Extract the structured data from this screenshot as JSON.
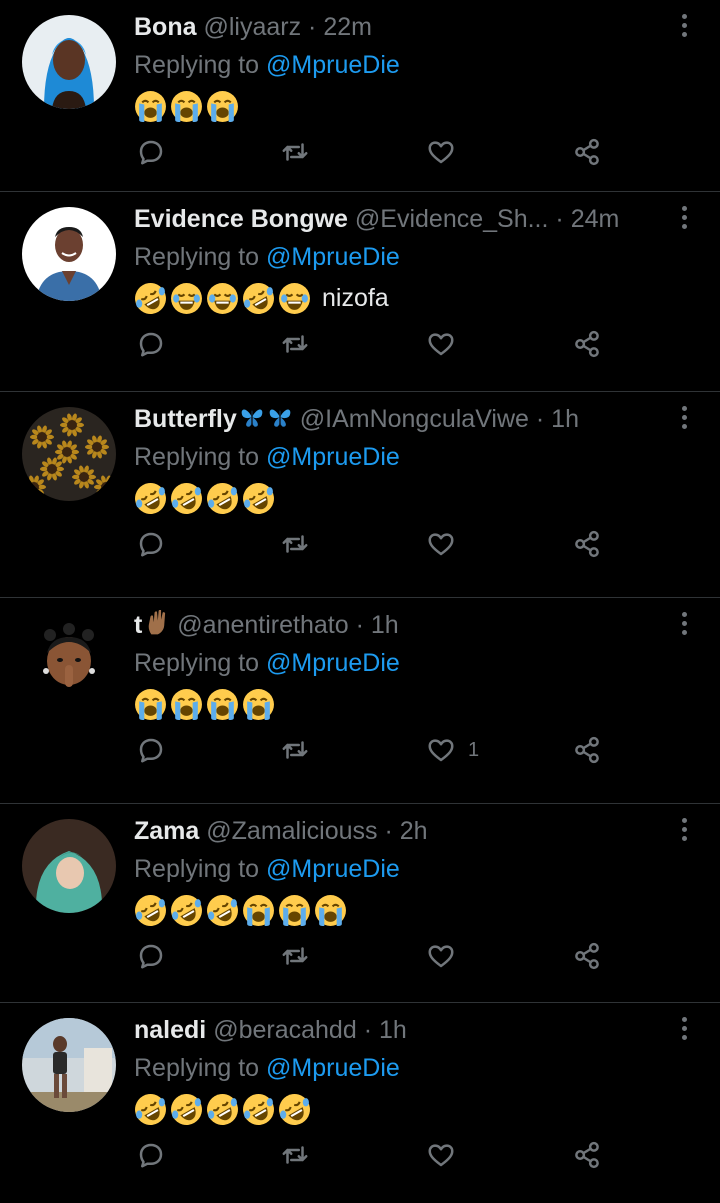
{
  "replying_label": "Replying to",
  "tweets": [
    {
      "name": "Bona",
      "name_emojis": [],
      "handle": "@liyaarz",
      "dot": "·",
      "time": "22m",
      "mention": "@MprueDie",
      "emojis": [
        "cry",
        "cry",
        "cry"
      ],
      "text": "",
      "likes": "",
      "avatar": "blue-hair-woman"
    },
    {
      "name": "Evidence Bongwe",
      "name_emojis": [],
      "handle": "@Evidence_Sh...",
      "dot": "·",
      "time": "24m",
      "mention": "@MprueDie",
      "emojis": [
        "rofl",
        "joy",
        "joy",
        "rofl",
        "joy"
      ],
      "text": "nizofa",
      "likes": "",
      "avatar": "smiling-man"
    },
    {
      "name": "Butterfly",
      "name_emojis": [
        "butterfly",
        "butterfly"
      ],
      "handle": "@IAmNongculaViwe",
      "dot": "·",
      "time": "1h",
      "mention": "@MprueDie",
      "emojis": [
        "rofl",
        "rofl",
        "rofl",
        "rofl"
      ],
      "text": "",
      "likes": "",
      "avatar": "sunflowers"
    },
    {
      "name": "t",
      "name_emojis": [
        "raised-hand"
      ],
      "handle": "@anentirethato",
      "dot": "·",
      "time": "1h",
      "mention": "@MprueDie",
      "emojis": [
        "cry",
        "cry",
        "cry",
        "cry"
      ],
      "text": "",
      "likes": "1",
      "avatar": "memoji"
    },
    {
      "name": "Zama",
      "name_emojis": [],
      "handle": "@Zamaliciouss",
      "dot": "·",
      "time": "2h",
      "mention": "@MprueDie",
      "emojis": [
        "rofl",
        "rofl",
        "rofl",
        "cry",
        "cry",
        "cry"
      ],
      "text": "",
      "likes": "",
      "avatar": "child-teal-wrap"
    },
    {
      "name": "naledi",
      "name_emojis": [],
      "handle": "@beracahdd",
      "dot": "·",
      "time": "1h",
      "mention": "@MprueDie",
      "emojis": [
        "rofl",
        "rofl",
        "rofl",
        "rofl",
        "rofl"
      ],
      "text": "",
      "likes": "",
      "avatar": "outdoor-person"
    }
  ]
}
